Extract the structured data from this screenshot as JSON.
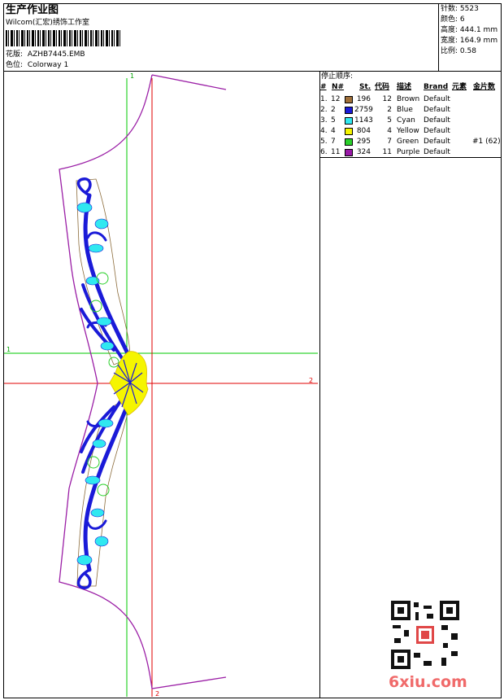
{
  "header": {
    "title": "生产作业图",
    "company": "Wilcom(汇宏)绣饰工作室",
    "design_label": "花版:",
    "design_file": "AZHB7445.EMB",
    "colorway_label": "色位:",
    "colorway": "Colorway 1"
  },
  "stats": [
    {
      "label": "针数:",
      "value": "5523"
    },
    {
      "label": "颜色:",
      "value": "6"
    },
    {
      "label": "高度:",
      "value": "444.1 mm"
    },
    {
      "label": "宽度:",
      "value": "164.9 mm"
    },
    {
      "label": "比例:",
      "value": "0.58"
    }
  ],
  "stop_sequence": {
    "heading": "停止顺序:",
    "columns": [
      "#",
      "N#",
      "St.",
      "代码",
      "描述",
      "Brand",
      "元素",
      "金片数"
    ],
    "rows": [
      {
        "idx": "1.",
        "n": "12",
        "color": "#a0703a",
        "st": "196",
        "code": "12",
        "desc": "Brown",
        "brand": "Default",
        "element": "",
        "sequins": ""
      },
      {
        "idx": "2.",
        "n": "2",
        "color": "#1a1ad8",
        "st": "2759",
        "code": "2",
        "desc": "Blue",
        "brand": "Default",
        "element": "",
        "sequins": ""
      },
      {
        "idx": "3.",
        "n": "5",
        "color": "#30e8f0",
        "st": "1143",
        "code": "5",
        "desc": "Cyan",
        "brand": "Default",
        "element": "",
        "sequins": ""
      },
      {
        "idx": "4.",
        "n": "4",
        "color": "#f5f500",
        "st": "804",
        "code": "4",
        "desc": "Yellow",
        "brand": "Default",
        "element": "",
        "sequins": ""
      },
      {
        "idx": "5.",
        "n": "7",
        "color": "#2ad02a",
        "st": "295",
        "code": "7",
        "desc": "Green",
        "brand": "Default",
        "element": "",
        "sequins": "#1 (62)"
      },
      {
        "idx": "6.",
        "n": "11",
        "color": "#9a1aa8",
        "st": "324",
        "code": "11",
        "desc": "Purple",
        "brand": "Default",
        "element": "",
        "sequins": ""
      }
    ]
  },
  "canvas": {
    "axis_labels": {
      "v1": "1",
      "h1": "1",
      "h2": "2",
      "v2": "2"
    },
    "colors": {
      "green_axis": "#00c800",
      "red_axis": "#e00000",
      "outline": "#9b1fa6",
      "guide": "#8b6b3a"
    }
  },
  "watermark": {
    "text": "6xiu.com",
    "color": "#f06a6a"
  },
  "qr_stamp": "QR code"
}
